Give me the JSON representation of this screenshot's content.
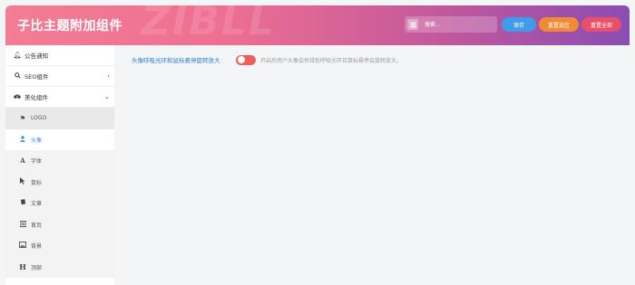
{
  "header": {
    "title": "子比主题附加组件",
    "watermark": "ZIBLL",
    "search_placeholder": "搜索...",
    "save_label": "保存",
    "reset_section_label": "重置选区",
    "reset_all_label": "重置全部"
  },
  "sidebar": {
    "items": [
      {
        "label": "公告通知",
        "icon": "bell-icon"
      },
      {
        "label": "SEO组件",
        "icon": "search-icon"
      },
      {
        "label": "美化组件",
        "icon": "palette-icon"
      }
    ],
    "sub_items": [
      {
        "label": "LOGO",
        "icon": "flag-icon"
      },
      {
        "label": "头像",
        "icon": "user-icon"
      },
      {
        "label": "字体",
        "icon": "font-icon"
      },
      {
        "label": "鼠标",
        "icon": "cursor-icon"
      },
      {
        "label": "文章",
        "icon": "book-icon"
      },
      {
        "label": "首页",
        "icon": "list-icon"
      },
      {
        "label": "背景",
        "icon": "image-icon"
      },
      {
        "label": "顶部",
        "icon": "heading-icon"
      }
    ]
  },
  "main": {
    "setting_label": "头像呼吸光环和鼠标悬停旋转放大",
    "setting_desc": "开启后用户头像会有绿色呼吸光环且鼠标悬停会旋转放大。",
    "toggle_enabled": true
  },
  "colors": {
    "header_start": "#f37d94",
    "header_end": "#8a4db2",
    "accent_blue": "#2e8ee8",
    "toggle": "#ee5c5c"
  }
}
